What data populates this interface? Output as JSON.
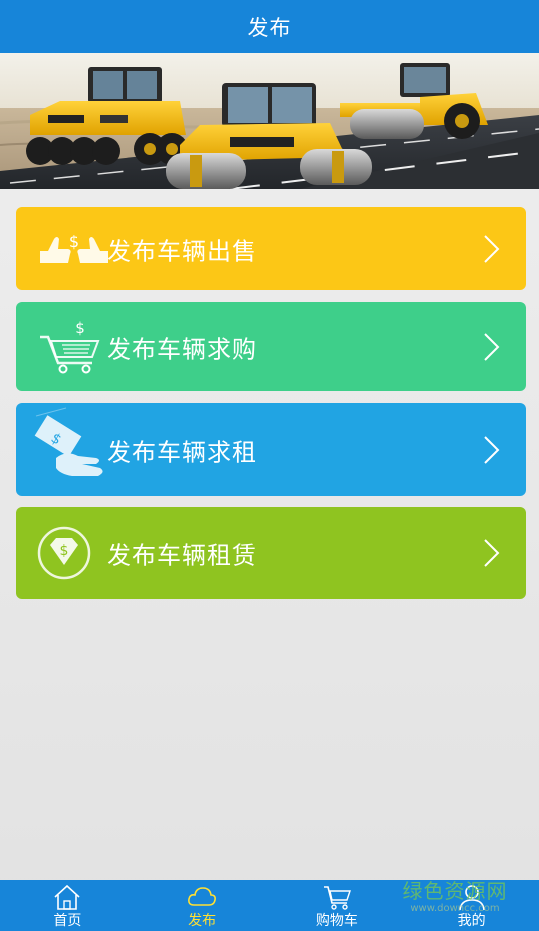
{
  "header": {
    "title": "发布"
  },
  "banner": {
    "image": "road-rollers-banner"
  },
  "menu": {
    "items": [
      {
        "label": "发布车辆出售",
        "icon": "handshake-dollar-icon",
        "color": "#fcc716"
      },
      {
        "label": "发布车辆求购",
        "icon": "shopping-cart-dollar-icon",
        "color": "#3ecf8a"
      },
      {
        "label": "发布车辆求租",
        "icon": "hand-money-icon",
        "color": "#21a4e3"
      },
      {
        "label": "发布车辆租赁",
        "icon": "diamond-dollar-icon",
        "color": "#8fc420"
      }
    ],
    "arrow_icon": "chevron-right-icon"
  },
  "tabbar": {
    "tabs": [
      {
        "label": "首页",
        "icon": "home-icon",
        "active": false
      },
      {
        "label": "发布",
        "icon": "cloud-icon",
        "active": true
      },
      {
        "label": "购物车",
        "icon": "cart-icon",
        "active": false
      },
      {
        "label": "我的",
        "icon": "user-icon",
        "active": false
      }
    ],
    "active_color": "#ffe033"
  },
  "watermark": {
    "line1": "绿色资源网",
    "line2": "www.downcc.com"
  }
}
